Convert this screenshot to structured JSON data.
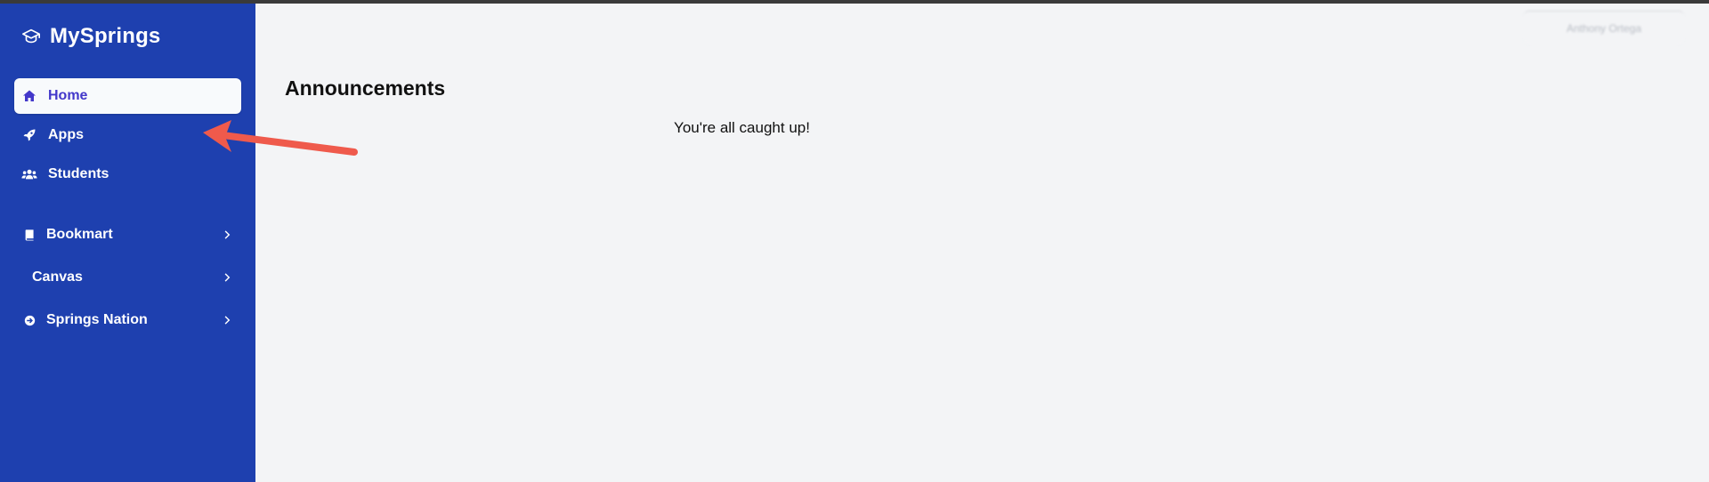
{
  "app": {
    "title": "MySprings"
  },
  "sidebar": {
    "items": [
      {
        "label": "Home",
        "icon": "home-icon",
        "active": true
      },
      {
        "label": "Apps",
        "icon": "rocket-icon",
        "active": false
      },
      {
        "label": "Students",
        "icon": "users-icon",
        "active": false
      },
      {
        "label": "Bookmart",
        "icon": "book-icon",
        "active": false,
        "expandable": true
      },
      {
        "label": "Canvas",
        "icon": "",
        "active": false,
        "expandable": true
      },
      {
        "label": "Springs Nation",
        "icon": "arrow-circle-icon",
        "active": false,
        "expandable": true
      }
    ]
  },
  "main": {
    "title": "Announcements",
    "empty_message": "You're all caught up!"
  },
  "user_menu": {
    "label": "Anthony Ortega"
  },
  "colors": {
    "sidebar_bg": "#1e40af",
    "active_text": "#4338ca",
    "annotation_arrow": "#ef5a4c"
  }
}
